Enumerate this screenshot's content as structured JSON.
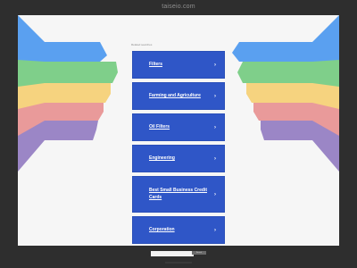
{
  "page": {
    "domain": "taiseio.com"
  },
  "related": {
    "label": "Related searches",
    "items": [
      {
        "label": "Filters"
      },
      {
        "label": "Farming and Agriculture"
      },
      {
        "label": "Oil Filters"
      },
      {
        "label": "Engineering"
      },
      {
        "label": "Best Small Business Credit Cards"
      },
      {
        "label": "Corporation"
      }
    ]
  },
  "search": {
    "placeholder": "",
    "button_label": "Search"
  },
  "colors": {
    "background": "#2e2e2e",
    "panel": "#f6f6f6",
    "link_button": "#2f56c7",
    "fan_blue": "#5aa0f0",
    "fan_green": "#7fcf8a",
    "fan_yellow": "#f6d37f",
    "fan_red": "#e99a9a",
    "fan_purple": "#9b86c6"
  },
  "icons": {
    "link_arrow": "chevron-right-icon"
  }
}
